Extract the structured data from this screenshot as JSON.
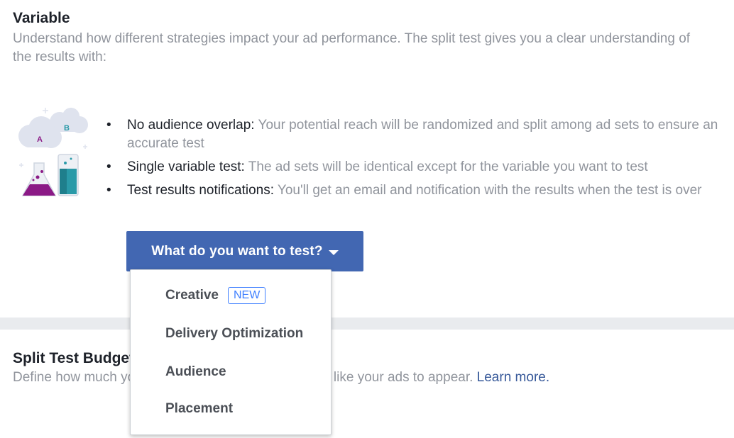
{
  "variable_section": {
    "title": "Variable",
    "description": "Understand how different strategies impact your ad performance. The split test gives you a clear understanding of the results with:",
    "bullets": [
      {
        "title": "No audience overlap:",
        "text": "Your potential reach will be randomized and split among ad sets to ensure an accurate test"
      },
      {
        "title": "Single variable test:",
        "text": "The ad sets will be identical except for the variable you want to test"
      },
      {
        "title": "Test results notifications:",
        "text": "You'll get an email and notification with the results when the test is over"
      }
    ],
    "bullet_symbol": "•",
    "illustration_letters": {
      "a": "A",
      "b": "B"
    },
    "button_label": "What do you want to test?"
  },
  "dropdown": {
    "items": [
      {
        "label": "Creative",
        "badge": "NEW"
      },
      {
        "label": "Delivery Optimization"
      },
      {
        "label": "Audience"
      },
      {
        "label": "Placement"
      }
    ]
  },
  "budget_section": {
    "title": "Split Test Budget",
    "description_start": "Define how much you'd like to spend and when you'd like your ads to appear.",
    "link": "Learn more."
  },
  "colors": {
    "primary_button": "#4267b2",
    "text_primary": "#1d2129",
    "text_secondary": "#90949c",
    "link": "#365899",
    "badge": "#4080ff",
    "divider": "#e9ebee"
  }
}
